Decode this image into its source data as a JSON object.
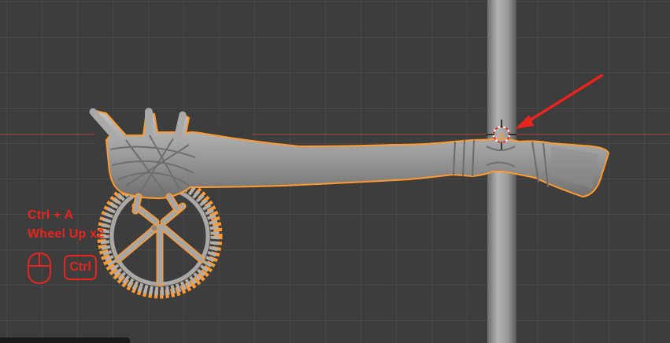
{
  "viewport": {
    "grid": true,
    "background": "#3d3d3d",
    "axis_color": "#a5433f"
  },
  "scene": {
    "selection_outline_color": "#ff9a2e",
    "mesh_color": "#9a9a9a",
    "icons": [
      "3d-cursor-icon",
      "red-arrow-icon"
    ]
  },
  "shortcut_overlay": {
    "line1": "Ctrl + A",
    "line2": "Wheel Up x2",
    "key_label": "Ctrl",
    "color": "#e8241d",
    "icons": [
      "mouse-icon"
    ]
  }
}
